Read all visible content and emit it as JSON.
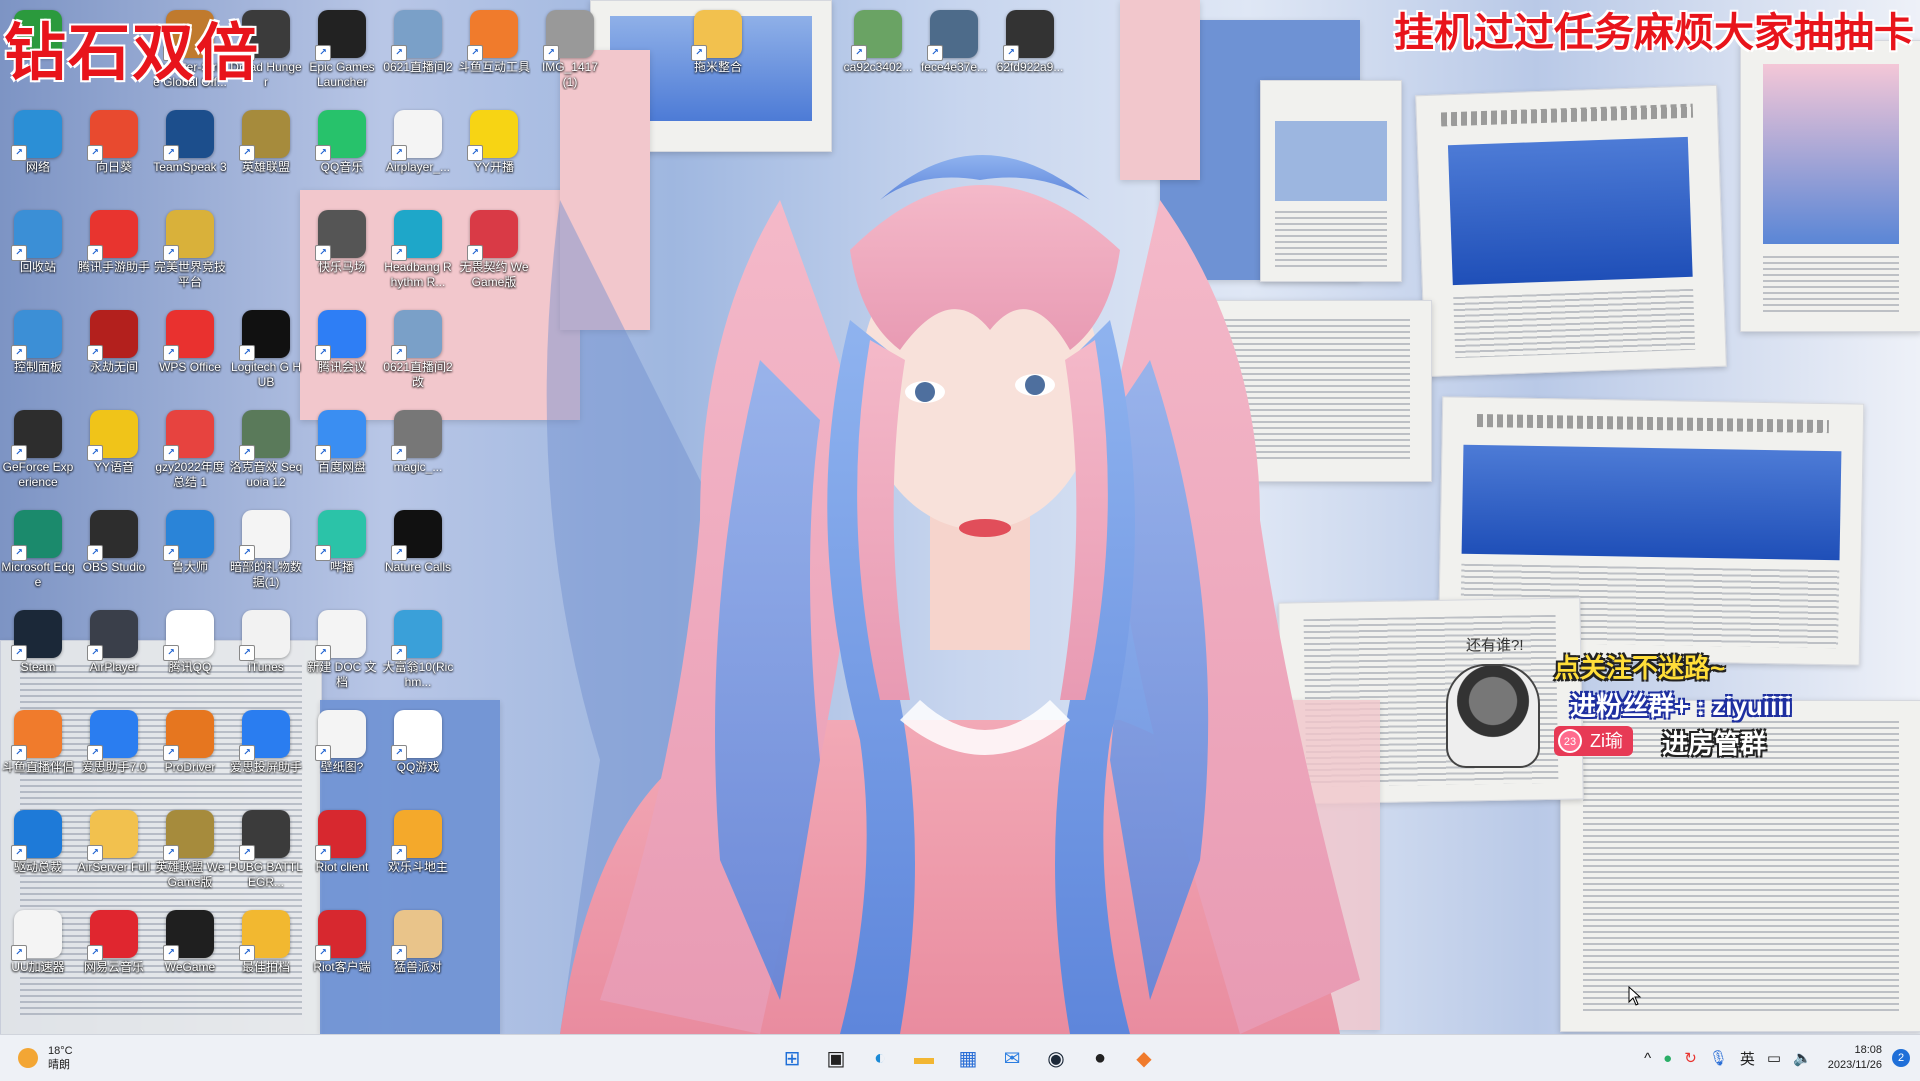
{
  "overlay": {
    "title": "钻石双倍",
    "top_right": "挂机过过任务麻烦大家抽抽卡"
  },
  "promo": {
    "who": "还有谁?!",
    "line1": "点关注不迷路~",
    "line2": "进粉丝群+ : ziyuiiii",
    "badge_level": "23",
    "badge_name": "Zi瑜",
    "line3": "进房管群"
  },
  "desktop_icons": [
    {
      "label": "",
      "icon": "app-icon",
      "color": "#2b9a3d"
    },
    {
      "label": "Counter-Strike Global Off...",
      "icon": "cs-icon",
      "color": "#c07a2d"
    },
    {
      "label": "Dread Hunger",
      "icon": "dread-icon",
      "color": "#3b3b3b"
    },
    {
      "label": "Epic Games Launcher",
      "icon": "epic-icon",
      "color": "#222"
    },
    {
      "label": "0621直播间2",
      "icon": "image-icon",
      "color": "#7aa0c8"
    },
    {
      "label": "斗鱼互动工具",
      "icon": "douyu-icon",
      "color": "#f07b2c"
    },
    {
      "label": "IMG_1417 (1)",
      "icon": "image-icon",
      "color": "#999"
    },
    {
      "label": "拖米整合",
      "icon": "folder-icon",
      "color": "#f2c14e"
    },
    {
      "label": "ca92c3402...",
      "icon": "image-icon",
      "color": "#6aa364"
    },
    {
      "label": "fece4e37e...",
      "icon": "image-icon",
      "color": "#4d6b8a"
    },
    {
      "label": "62fd922a9...",
      "icon": "image-icon",
      "color": "#333"
    },
    {
      "label": "网络",
      "icon": "network-icon",
      "color": "#2b8fd6"
    },
    {
      "label": "向日葵",
      "icon": "sunlogin-icon",
      "color": "#e84a2f"
    },
    {
      "label": "TeamSpeak 3",
      "icon": "teamspeak-icon",
      "color": "#1c4e8c"
    },
    {
      "label": "英雄联盟",
      "icon": "lol-icon",
      "color": "#a68b3c"
    },
    {
      "label": "QQ音乐",
      "icon": "qqmusic-icon",
      "color": "#27c26b"
    },
    {
      "label": "Airplayer_...",
      "icon": "file-icon",
      "color": "#f4f4f4"
    },
    {
      "label": "YY开播",
      "icon": "yy-icon",
      "color": "#f7d414"
    },
    {
      "label": "回收站",
      "icon": "recycle-bin-icon",
      "color": "#3b8fd6"
    },
    {
      "label": "腾讯手游助手",
      "icon": "tencent-game-icon",
      "color": "#e8342f"
    },
    {
      "label": "完美世界竞技平台",
      "icon": "perfect-world-icon",
      "color": "#d9b13a"
    },
    {
      "label": "快乐马场",
      "icon": "image-icon",
      "color": "#555"
    },
    {
      "label": "Headbang Rhythm R...",
      "icon": "headbang-icon",
      "color": "#1ea7c9"
    },
    {
      "label": "无畏契约 WeGame版",
      "icon": "valorant-icon",
      "color": "#d93a46"
    },
    {
      "label": "控制面板",
      "icon": "control-panel-icon",
      "color": "#3c8fd6"
    },
    {
      "label": "永劫无间",
      "icon": "naraka-icon",
      "color": "#b3201d"
    },
    {
      "label": "WPS Office",
      "icon": "wps-icon",
      "color": "#e9312f"
    },
    {
      "label": "Logitech G HUB",
      "icon": "logitech-icon",
      "color": "#111"
    },
    {
      "label": "腾讯会议",
      "icon": "tencent-meeting-icon",
      "color": "#2e7ef5"
    },
    {
      "label": "0621直播间2 改",
      "icon": "image-icon",
      "color": "#7aa0c8"
    },
    {
      "label": "GeForce Experience",
      "icon": "nvidia-icon",
      "color": "#2d2d2d"
    },
    {
      "label": "YY语音",
      "icon": "yy-voice-icon",
      "color": "#f0c419"
    },
    {
      "label": "gzy2022年度总结 1",
      "icon": "pdf-icon",
      "color": "#e7433f"
    },
    {
      "label": "洛克音效 Sequoia 12",
      "icon": "sequoia-icon",
      "color": "#5a7a5a"
    },
    {
      "label": "百度网盘",
      "icon": "baidu-netdisk-icon",
      "color": "#3a8ef2"
    },
    {
      "label": "magic_...",
      "icon": "image-icon",
      "color": "#777"
    },
    {
      "label": "Microsoft Edge",
      "icon": "edge-icon",
      "color": "#1b8a6c"
    },
    {
      "label": "OBS Studio",
      "icon": "obs-icon",
      "color": "#2d2d2d"
    },
    {
      "label": "鲁大师",
      "icon": "ludashi-icon",
      "color": "#2a84d8"
    },
    {
      "label": "暗部的礼物数据(1)",
      "icon": "sheet-icon",
      "color": "#f4f4f4"
    },
    {
      "label": "哔播",
      "icon": "bibo-icon",
      "color": "#2bc3a8"
    },
    {
      "label": "Nature Calls",
      "icon": "game-icon",
      "color": "#111"
    },
    {
      "label": "Steam",
      "icon": "steam-icon",
      "color": "#1b2838"
    },
    {
      "label": "AirPlayer",
      "icon": "airplayer-icon",
      "color": "#3a3f4a"
    },
    {
      "label": "腾讯QQ",
      "icon": "qq-icon",
      "color": "#ffffff"
    },
    {
      "label": "iTunes",
      "icon": "itunes-icon",
      "color": "#f2f2f2"
    },
    {
      "label": "新建 DOC 文档",
      "icon": "doc-icon",
      "color": "#f4f4f4"
    },
    {
      "label": "大富翁10(Richm...",
      "icon": "richman-icon",
      "color": "#3aa0d9"
    },
    {
      "label": "斗鱼直播伴侣",
      "icon": "douyu-icon",
      "color": "#f07b2c"
    },
    {
      "label": "爱思助手7.0",
      "icon": "i4-icon",
      "color": "#2a7df0"
    },
    {
      "label": "ProDriver",
      "icon": "prodriver-icon",
      "color": "#e6761f"
    },
    {
      "label": "爱思投屏助手",
      "icon": "i4-cast-icon",
      "color": "#2a7df0"
    },
    {
      "label": "壁纸图?",
      "icon": "file-icon",
      "color": "#f4f4f4"
    },
    {
      "label": "QQ游戏",
      "icon": "qq-game-icon",
      "color": "#ffffff"
    },
    {
      "label": "驱动总裁",
      "icon": "driver-icon",
      "color": "#1e7ad8"
    },
    {
      "label": "AirServer Full",
      "icon": "folder-icon",
      "color": "#f2c14e"
    },
    {
      "label": "英雄联盟 WeGame版",
      "icon": "lol-icon",
      "color": "#a68b3c"
    },
    {
      "label": "PUBG BATTLEGR...",
      "icon": "pubg-icon",
      "color": "#3b3b3b"
    },
    {
      "label": "Riot client",
      "icon": "riot-icon",
      "color": "#d7282f"
    },
    {
      "label": "欢乐斗地主",
      "icon": "doudizhu-icon",
      "color": "#f4a92b"
    },
    {
      "label": "UU加速器",
      "icon": "file-icon",
      "color": "#f4f4f4"
    },
    {
      "label": "网易云音乐",
      "icon": "netease-music-icon",
      "color": "#e0262f"
    },
    {
      "label": "WeGame",
      "icon": "wegame-icon",
      "color": "#1f1f1f"
    },
    {
      "label": "最佳拍档",
      "icon": "game-icon",
      "color": "#f2b830"
    },
    {
      "label": "Riot客户端",
      "icon": "riot-icon",
      "color": "#d7282f"
    },
    {
      "label": "猛兽派对",
      "icon": "party-animals-icon",
      "color": "#e9c48a"
    }
  ],
  "taskbar": {
    "weather_temp": "18°C",
    "weather_desc": "晴朗",
    "apps": [
      {
        "name": "start-button",
        "glyph": "⊞",
        "color": "#1f6fd8"
      },
      {
        "name": "task-view",
        "glyph": "▣",
        "color": "#222"
      },
      {
        "name": "edge",
        "glyph": "◐",
        "color": "#1b8ad6"
      },
      {
        "name": "file-explorer",
        "glyph": "▬",
        "color": "#f2b632"
      },
      {
        "name": "microsoft-store",
        "glyph": "▦",
        "color": "#2b6fd6"
      },
      {
        "name": "mail",
        "glyph": "✉",
        "color": "#2b7de0"
      },
      {
        "name": "steam",
        "glyph": "◉",
        "color": "#1b2838"
      },
      {
        "name": "obs",
        "glyph": "●",
        "color": "#222"
      },
      {
        "name": "douyu",
        "glyph": "◆",
        "color": "#f07b2c"
      }
    ],
    "tray_ime": "英",
    "time": "18:08",
    "date": "2023/11/26",
    "notification_count": "2"
  }
}
